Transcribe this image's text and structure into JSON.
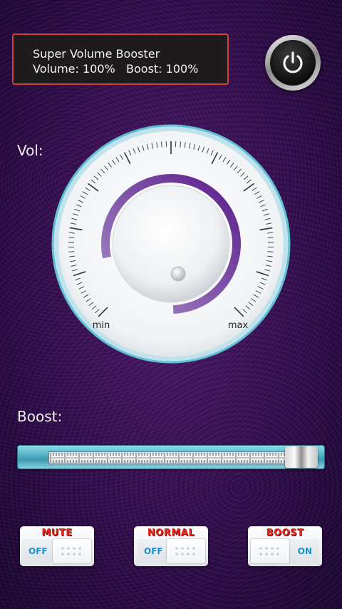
{
  "info_panel": {
    "title": "Super Volume Booster",
    "volume_label": "Volume:",
    "volume_value": "100%",
    "boost_label": "Boost:",
    "boost_value": "100%"
  },
  "power_button": {
    "icon": "power-icon"
  },
  "volume_section": {
    "label": "Vol:",
    "min_label": "min",
    "max_label": "max",
    "level_fraction": 1.0
  },
  "boost_section": {
    "label": "Boost:",
    "level_fraction": 1.0
  },
  "toggles": [
    {
      "title": "MUTE",
      "state": "OFF",
      "on": false
    },
    {
      "title": "NORMAL",
      "state": "OFF",
      "on": false
    },
    {
      "title": "BOOST",
      "state": "ON",
      "on": true
    }
  ],
  "colors": {
    "background": "#3a0f57",
    "panel_border": "#d0433c",
    "arc": "#6a2a93",
    "toggle_title": "#e8261e",
    "toggle_state": "#1a8fcf",
    "slider_frame": "#57b3c6"
  }
}
